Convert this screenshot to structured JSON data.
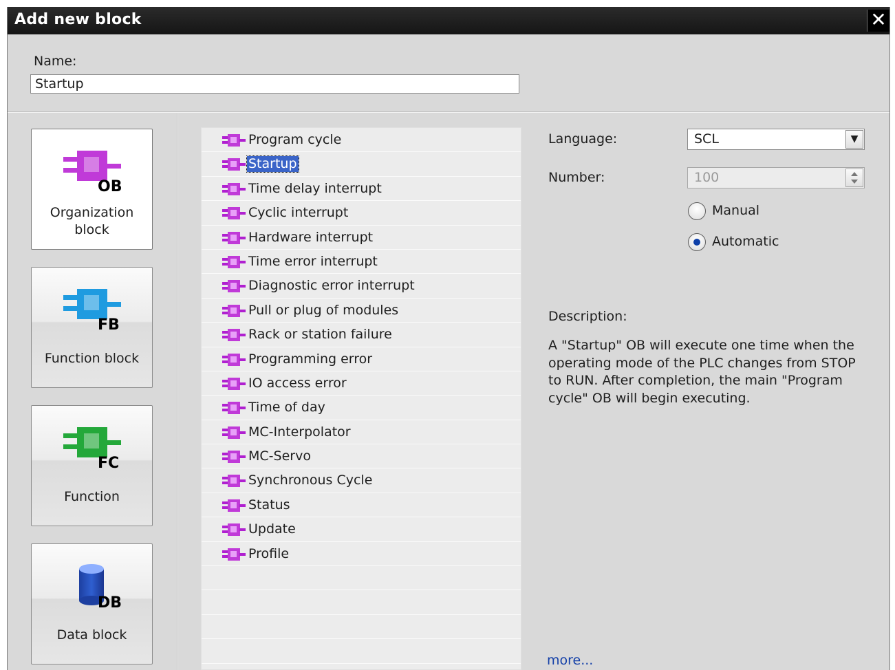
{
  "dialog": {
    "title": "Add new block",
    "close_label": "✕"
  },
  "name": {
    "label": "Name:",
    "value": "Startup"
  },
  "block_types": [
    {
      "label": "Organization block",
      "icon_text": "OB",
      "icon": "organization-block-icon",
      "color": "#c03ad8",
      "selected": true
    },
    {
      "label": "Function block",
      "icon_text": "FB",
      "icon": "function-block-icon",
      "color": "#1f9be0",
      "selected": false
    },
    {
      "label": "Function",
      "icon_text": "FC",
      "icon": "function-icon",
      "color": "#24a83a",
      "selected": false
    },
    {
      "label": "Data block",
      "icon_text": "DB",
      "icon": "data-block-icon",
      "color": "#2f5fd0",
      "selected": false
    }
  ],
  "ob_list": {
    "selected_index": 1,
    "items": [
      "Program cycle",
      "Startup",
      "Time delay interrupt",
      "Cyclic interrupt",
      "Hardware interrupt",
      "Time error interrupt",
      "Diagnostic error interrupt",
      "Pull or plug of modules",
      "Rack or station failure",
      "Programming error",
      "IO access error",
      "Time of day",
      "MC-Interpolator",
      "MC-Servo",
      "Synchronous Cycle",
      "Status",
      "Update",
      "Profile"
    ],
    "empty_rows": 4
  },
  "properties": {
    "language_label": "Language:",
    "language_value": "SCL",
    "number_label": "Number:",
    "number_value": "100",
    "manual_label": "Manual",
    "automatic_label": "Automatic",
    "numbering_mode": "automatic"
  },
  "description": {
    "label": "Description:",
    "text": "A \"Startup\" OB will execute one time when the operating mode of the PLC changes from STOP to RUN. After completion, the main \"Program cycle\" OB will begin executing.",
    "more_link": "more..."
  },
  "colors": {
    "selection": "#3a64c8",
    "titlebar": "#1e1e1e",
    "link": "#1440a8"
  }
}
